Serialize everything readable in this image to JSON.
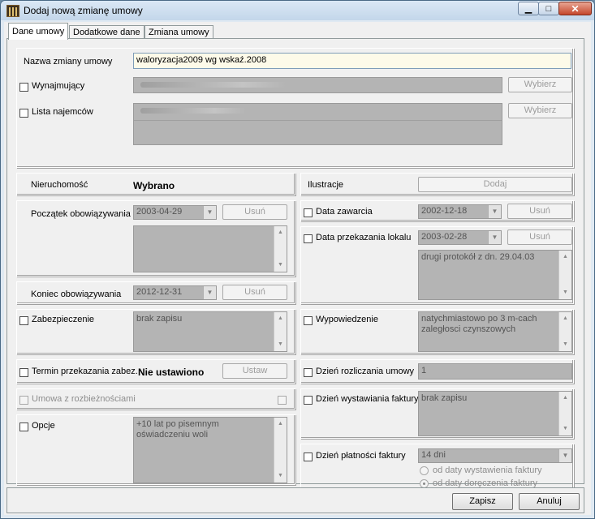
{
  "window": {
    "title": "Dodaj nową zmianę umowy"
  },
  "tabs": [
    "Dane umowy",
    "Dodatkowe dane",
    "Zmiana umowy"
  ],
  "top": {
    "name_label": "Nazwa zmiany umowy",
    "name_value": "waloryzacja2009 wg wskaź.2008",
    "landlord_label": "Wynajmujący",
    "landlord_button": "Wybierz",
    "tenants_label": "Lista najemców",
    "tenants_button": "Wybierz"
  },
  "left": {
    "property_label": "Nieruchomość",
    "property_value": "Wybrano",
    "start_label": "Początek obowiązywania",
    "start_date": "2003-04-29",
    "start_remove": "Usuń",
    "end_label": "Koniec obowiązywania",
    "end_date": "2012-12-31",
    "end_remove": "Usuń",
    "security_label": "Zabezpieczenie",
    "security_value": "brak zapisu",
    "security_deadline_label": "Termin przekazania zabez.",
    "security_deadline_value": "Nie ustawiono",
    "security_deadline_button": "Ustaw",
    "discrepancy_label": "Umowa z rozbieżnościami",
    "options_label": "Opcje",
    "options_value": "+10 lat po pisemnym oświadczeniu woli"
  },
  "right": {
    "illustrations_label": "Ilustracje",
    "illustrations_button": "Dodaj",
    "conclusion_label": "Data zawarcia",
    "conclusion_date": "2002-12-18",
    "conclusion_remove": "Usuń",
    "handover_label": "Data przekazania lokalu",
    "handover_date": "2003-02-28",
    "handover_remove": "Usuń",
    "handover_note": "drugi protokół z dn. 29.04.03",
    "termination_label": "Wypowiedzenie",
    "termination_value": "natychmiastowo po 3 m-cach zaległosci czynszowych",
    "settlement_label": "Dzień rozliczania umowy",
    "settlement_value": "1",
    "invoice_issue_label": "Dzień wystawiania faktury",
    "invoice_issue_value": "brak zapisu",
    "payment_label": "Dzień płatności faktury",
    "payment_value": "14 dni",
    "radio_from_issue": "od daty wystawienia faktury",
    "radio_from_delivery": "od daty doręczenia faktury"
  },
  "buttons": {
    "save": "Zapisz",
    "cancel": "Anuluj"
  }
}
